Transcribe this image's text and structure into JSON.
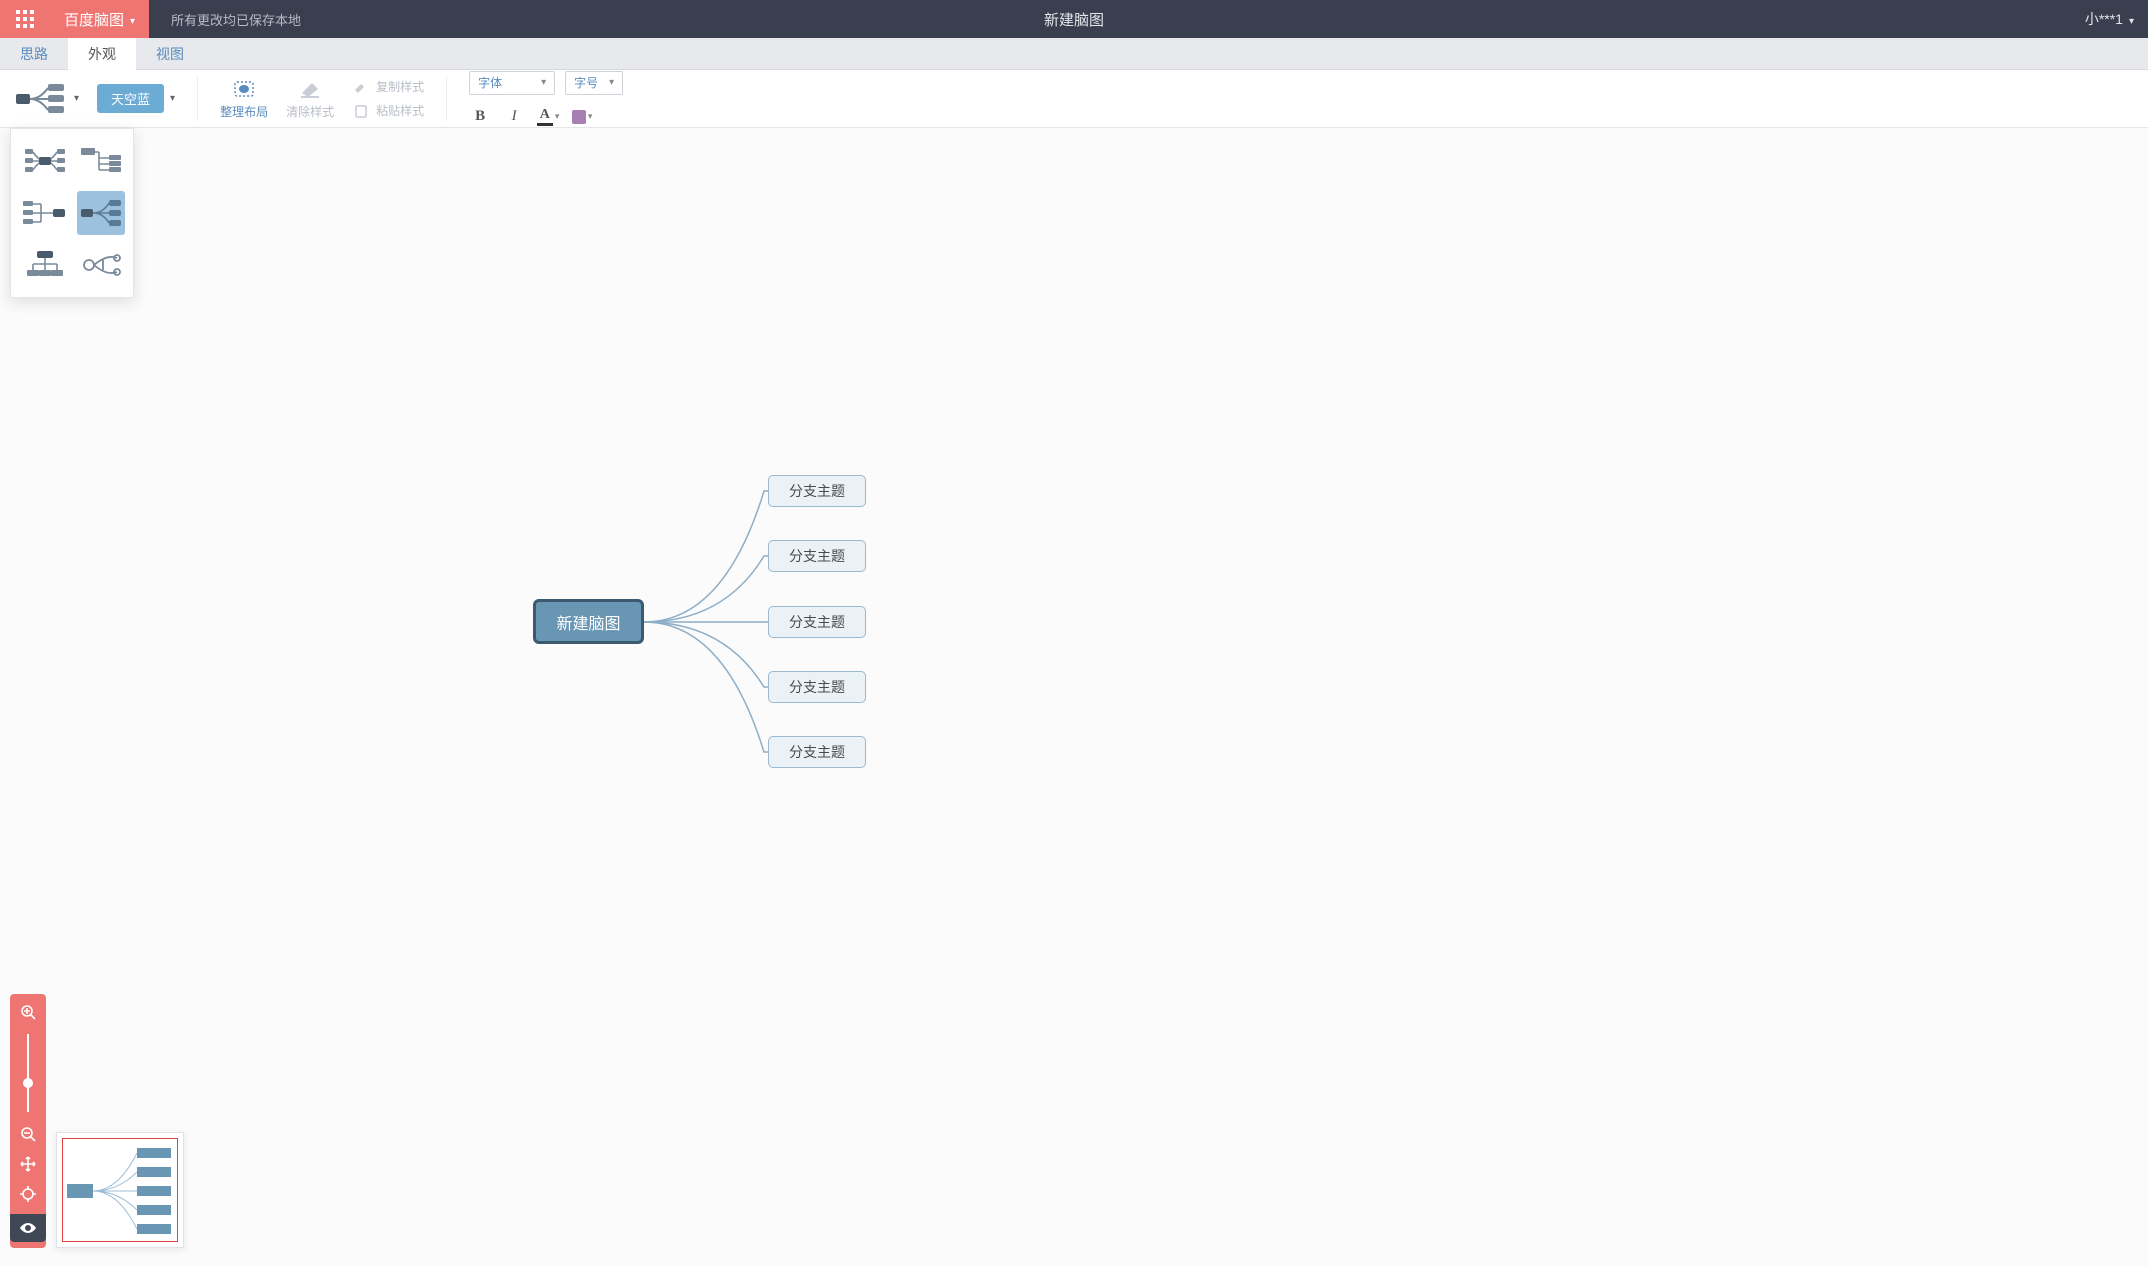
{
  "header": {
    "app_name": "百度脑图",
    "status": "所有更改均已保存本地",
    "doc_title": "新建脑图",
    "user": "小***1"
  },
  "tabs": {
    "t1": "思路",
    "t2": "外观",
    "t3": "视图"
  },
  "toolbar": {
    "theme": "天空蓝",
    "arrange": "整理布局",
    "clear_style": "清除样式",
    "copy_style": "复制样式",
    "paste_style": "粘贴样式",
    "font": "字体",
    "size": "字号"
  },
  "mindmap": {
    "root": "新建脑图",
    "children": [
      "分支主题",
      "分支主题",
      "分支主题",
      "分支主题",
      "分支主题"
    ]
  }
}
